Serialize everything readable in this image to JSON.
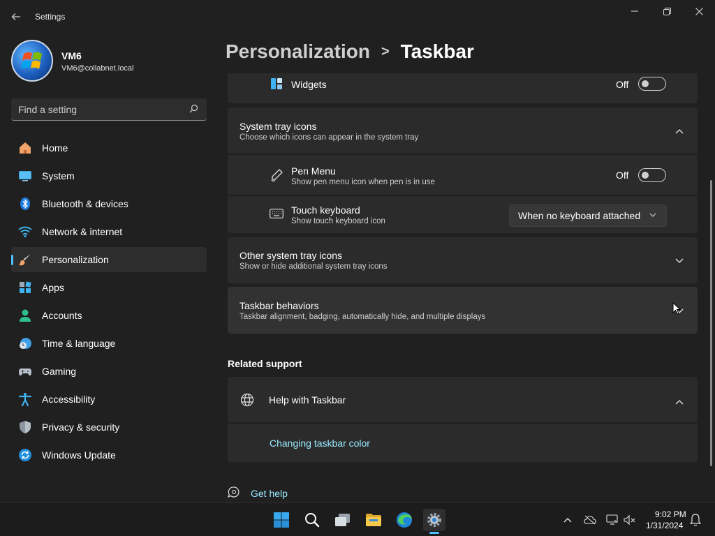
{
  "window": {
    "title": "Settings"
  },
  "profile": {
    "name": "VM6",
    "email": "VM6@collabnet.local"
  },
  "search": {
    "placeholder": "Find a setting"
  },
  "nav": {
    "items": [
      {
        "label": "Home",
        "icon": "home-icon",
        "active": false
      },
      {
        "label": "System",
        "icon": "system-icon",
        "active": false
      },
      {
        "label": "Bluetooth & devices",
        "icon": "bluetooth-icon",
        "active": false
      },
      {
        "label": "Network & internet",
        "icon": "wifi-icon",
        "active": false
      },
      {
        "label": "Personalization",
        "icon": "brush-icon",
        "active": true
      },
      {
        "label": "Apps",
        "icon": "apps-icon",
        "active": false
      },
      {
        "label": "Accounts",
        "icon": "person-icon",
        "active": false
      },
      {
        "label": "Time & language",
        "icon": "clock-globe-icon",
        "active": false
      },
      {
        "label": "Gaming",
        "icon": "gamepad-icon",
        "active": false
      },
      {
        "label": "Accessibility",
        "icon": "accessibility-icon",
        "active": false
      },
      {
        "label": "Privacy & security",
        "icon": "shield-icon",
        "active": false
      },
      {
        "label": "Windows Update",
        "icon": "update-icon",
        "active": false
      }
    ]
  },
  "breadcrumb": {
    "parent": "Personalization",
    "separator": ">",
    "current": "Taskbar"
  },
  "widgets": {
    "label": "Widgets",
    "state": "Off"
  },
  "system_tray": {
    "title": "System tray icons",
    "subtitle": "Choose which icons can appear in the system tray",
    "items": {
      "pen_menu": {
        "title": "Pen Menu",
        "subtitle": "Show pen menu icon when pen is in use",
        "state": "Off"
      },
      "touch_keyboard": {
        "title": "Touch keyboard",
        "subtitle": "Show touch keyboard icon",
        "value": "When no keyboard attached"
      }
    }
  },
  "other_tray": {
    "title": "Other system tray icons",
    "subtitle": "Show or hide additional system tray icons"
  },
  "behaviors": {
    "title": "Taskbar behaviors",
    "subtitle": "Taskbar alignment, badging, automatically hide, and multiple displays"
  },
  "related": {
    "heading": "Related support",
    "help_title": "Help with Taskbar",
    "link": "Changing taskbar color"
  },
  "footer": {
    "get_help": "Get help"
  },
  "taskbar": {
    "time": "9:02 PM",
    "date": "1/31/2024"
  },
  "colors": {
    "accent": "#4cc2ff",
    "background": "#202020",
    "card": "#2b2b2b",
    "link": "#99ebff"
  }
}
